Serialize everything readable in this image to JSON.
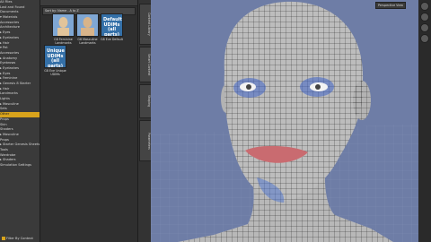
{
  "tree": {
    "items": [
      {
        "label": "All Files"
      },
      {
        "label": "Lost and Found"
      },
      {
        "label": "Documents"
      },
      {
        "label": "▾ Materials"
      },
      {
        "label": "     Accessories"
      },
      {
        "label": "     Architecture"
      },
      {
        "label": "   ▸ Eyes"
      },
      {
        "label": "   ▸ Eyelashes"
      },
      {
        "label": "   ▸ Hair"
      },
      {
        "label": "   ▾ Pet"
      },
      {
        "label": "      Accessories"
      },
      {
        "label": "    ▸ Anatomy"
      },
      {
        "label": "      Eyebrows"
      },
      {
        "label": "    ▸ Eyelashes"
      },
      {
        "label": "    ▸ Eyes"
      },
      {
        "label": "    ▸ Feminine"
      },
      {
        "label": "    ▸ Genesis 8 Starter"
      },
      {
        "label": "    ▸ Hair"
      },
      {
        "label": "      Landmarks"
      },
      {
        "label": "      Lights"
      },
      {
        "label": "    ▸ Masculine"
      },
      {
        "label": "      Sets"
      },
      {
        "label": "      Other",
        "selected": true
      },
      {
        "label": "      Props"
      },
      {
        "label": "      Skin"
      },
      {
        "label": "      Shaders"
      },
      {
        "label": "  ▸ Masculine"
      },
      {
        "label": "    Props"
      },
      {
        "label": "  ▸ Starter Genesis Sheets"
      },
      {
        "label": "    Tools"
      },
      {
        "label": "    Wardrobe"
      },
      {
        "label": "  ▸ Shaders"
      },
      {
        "label": "    Simulation Settings"
      }
    ],
    "filter_label": "Filter By Context"
  },
  "content": {
    "top_label": "",
    "sort_label": "Sort by: Name - A to Z",
    "thumbs": [
      {
        "label": "G8 Feminine Landmarks",
        "text": ""
      },
      {
        "label": "G8 Masculine Landmarks",
        "text": ""
      },
      {
        "label": "G8 Eve Default",
        "text": "Default UDIMs (all parts)"
      },
      {
        "label": "G8 Eve Unique UDIMs",
        "text": "Unique UDIMs (all parts)"
      }
    ]
  },
  "side_tabs": [
    "Content Library",
    "Smart Content",
    "Shaping",
    "Parameters"
  ],
  "viewport": {
    "camera_label": "Perspective View"
  }
}
